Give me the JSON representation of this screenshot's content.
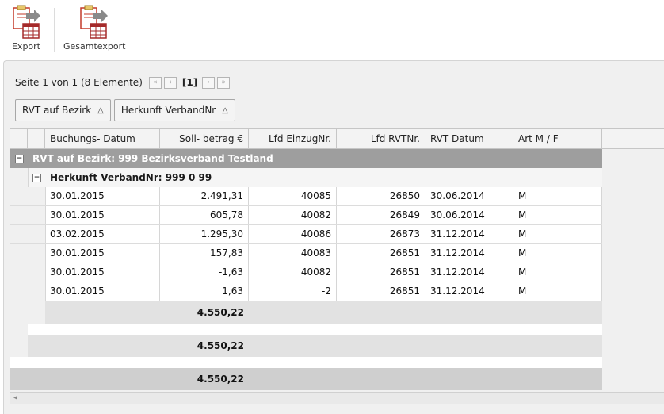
{
  "toolbar": {
    "export_label": "Export",
    "fullexport_label": "Gesamtexport"
  },
  "pager": {
    "text": "Seite 1 von 1 (8 Elemente)",
    "first": "«",
    "prev": "‹",
    "current": "[1]",
    "next": "›",
    "last": "»"
  },
  "grouping": {
    "chips": [
      {
        "label": "RVT auf Bezirk",
        "sort": "△"
      },
      {
        "label": "Herkunft VerbandNr",
        "sort": "△"
      }
    ]
  },
  "columns": {
    "datum": "Buchungs- Datum",
    "soll": "Soll- betrag €",
    "einzug": "Lfd EinzugNr.",
    "rvt": "Lfd RVTNr.",
    "rvtdatum": "RVT Datum",
    "art": "Art M / F"
  },
  "group1": {
    "label": "RVT auf Bezirk: 999 Bezirksverband Testland",
    "toggle": "−"
  },
  "group2": {
    "label": "Herkunft VerbandNr: 999 0 99",
    "toggle": "−"
  },
  "rows": [
    {
      "datum": "30.01.2015",
      "soll": "2.491,31",
      "einzug": "40085",
      "rvt": "26850",
      "rvtdatum": "30.06.2014",
      "art": "M"
    },
    {
      "datum": "30.01.2015",
      "soll": "605,78",
      "einzug": "40082",
      "rvt": "26849",
      "rvtdatum": "30.06.2014",
      "art": "M"
    },
    {
      "datum": "03.02.2015",
      "soll": "1.295,30",
      "einzug": "40086",
      "rvt": "26873",
      "rvtdatum": "31.12.2014",
      "art": "M"
    },
    {
      "datum": "30.01.2015",
      "soll": "157,83",
      "einzug": "40083",
      "rvt": "26851",
      "rvtdatum": "31.12.2014",
      "art": "M"
    },
    {
      "datum": "30.01.2015",
      "soll": "-1,63",
      "einzug": "40082",
      "rvt": "26851",
      "rvtdatum": "31.12.2014",
      "art": "M"
    },
    {
      "datum": "30.01.2015",
      "soll": "1,63",
      "einzug": "-2",
      "rvt": "26851",
      "rvtdatum": "31.12.2014",
      "art": "M"
    }
  ],
  "totals": {
    "group2": "4.550,22",
    "group1": "4.550,22",
    "grand": "4.550,22"
  },
  "scrollbar": {
    "left_arrow": "◂"
  }
}
